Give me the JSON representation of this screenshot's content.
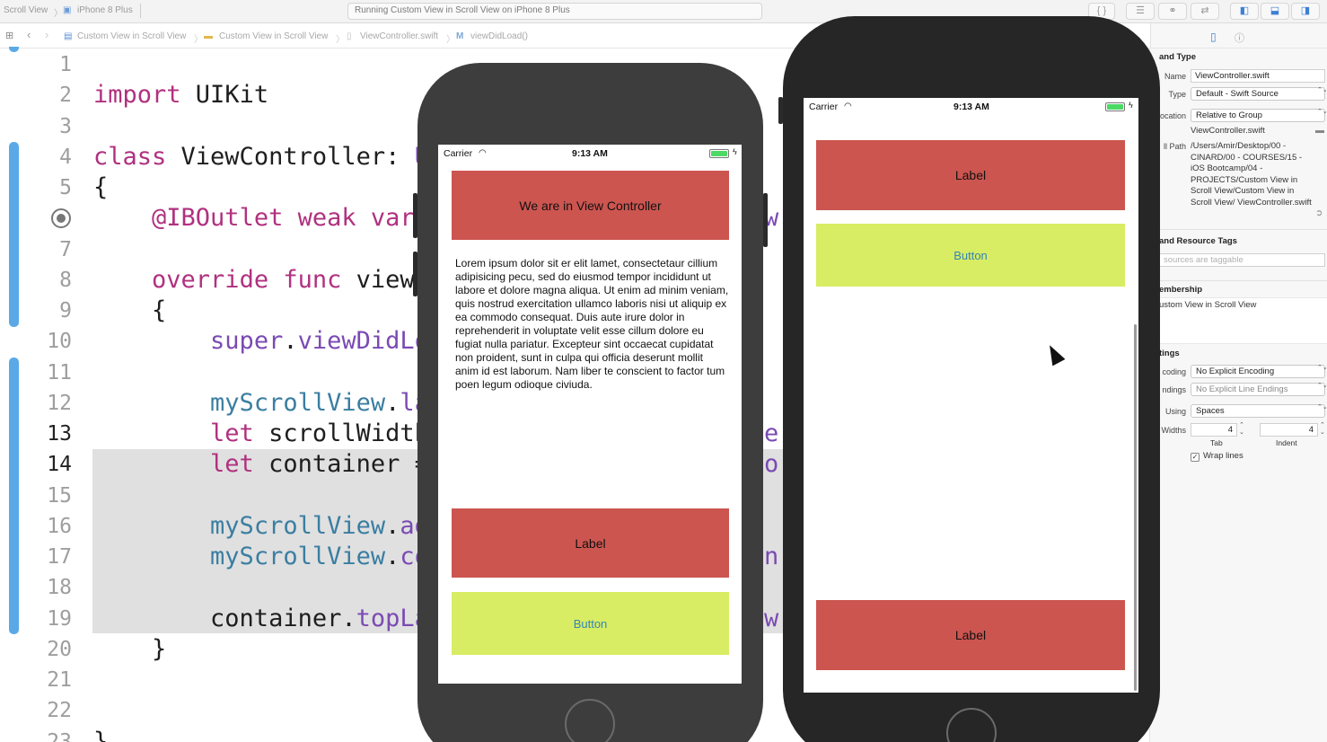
{
  "toolbar": {
    "crumb_project": "Scroll View",
    "crumb_device": "iPhone 8 Plus",
    "status": "Running Custom View in Scroll View on iPhone 8 Plus"
  },
  "jumpbar": {
    "items": [
      "Custom View in Scroll View",
      "Custom View in Scroll View",
      "ViewController.swift",
      "viewDidLoad()"
    ]
  },
  "editor": {
    "lines": [
      {
        "n": "1",
        "html": ""
      },
      {
        "n": "2",
        "html": "<span class='kw'>import</span> UIKit"
      },
      {
        "n": "3",
        "html": ""
      },
      {
        "n": "4",
        "html": "<span class='kw'>class</span> ViewController: <span class='prp'>U</span>"
      },
      {
        "n": "5",
        "html": "{"
      },
      {
        "n": "",
        "html": "    <span class='kw'>@IBOutlet weak var</span>"
      },
      {
        "n": "7",
        "html": ""
      },
      {
        "n": "8",
        "html": "    <span class='kw'>override func</span> viewD"
      },
      {
        "n": "9",
        "html": "    {"
      },
      {
        "n": "10",
        "html": "        <span class='prp'>super</span>.<span class='prp'>viewDidLo</span>"
      },
      {
        "n": "11",
        "html": ""
      },
      {
        "n": "12",
        "html": "        <span class='fn'>myScrollView</span>.<span class='prp'>lay</span>"
      },
      {
        "n": "13",
        "html": "        <span class='kw'>let</span> scrollWidth"
      },
      {
        "n": "14",
        "html": "        <span class='kw'>let</span> container ="
      },
      {
        "n": "15",
        "html": ""
      },
      {
        "n": "16",
        "html": "        <span class='fn'>myScrollView</span>.<span class='prp'>add</span>"
      },
      {
        "n": "17",
        "html": "        <span class='fn'>myScrollView</span>.<span class='prp'>co</span>"
      },
      {
        "n": "18",
        "html": ""
      },
      {
        "n": "19",
        "html": "        container.<span class='prp'>topLa</span>"
      },
      {
        "n": "20",
        "html": "    }"
      },
      {
        "n": "21",
        "html": ""
      },
      {
        "n": "22",
        "html": ""
      },
      {
        "n": "23",
        "html": "}"
      }
    ],
    "peek_right": [
      {
        "text": "w",
        "row": 5
      },
      {
        "text": "e",
        "row": 12
      },
      {
        "text": "o",
        "row": 13
      },
      {
        "text": "n",
        "row": 16
      },
      {
        "text": "w",
        "row": 18
      }
    ]
  },
  "phone_small": {
    "carrier": "Carrier",
    "time": "9:13 AM",
    "header": "We are in View Controller",
    "lorem": "Lorem ipsum dolor sit er elit lamet, consectetaur cillium adipisicing pecu, sed do eiusmod tempor incididunt ut labore et dolore magna aliqua. Ut enim ad minim veniam, quis nostrud exercitation ullamco laboris nisi ut aliquip ex ea commodo consequat. Duis aute irure dolor in reprehenderit in voluptate velit esse cillum dolore eu fugiat nulla pariatur. Excepteur sint occaecat cupidatat non proident, sunt in culpa qui officia deserunt mollit anim id est laborum. Nam liber te conscient to factor tum poen legum odioque civiuda.",
    "label": "Label",
    "button": "Button"
  },
  "phone_large": {
    "carrier": "Carrier",
    "time": "9:13 AM",
    "label_top": "Label",
    "button": "Button",
    "label_bottom": "Label"
  },
  "inspector": {
    "identity_title": "and Type",
    "name_label": "Name",
    "name_value": "ViewController.swift",
    "type_label": "Type",
    "type_value": "Default - Swift Source",
    "location_label": "ocation",
    "location_value": "Relative to Group",
    "location_file": "ViewController.swift",
    "path_label": "ll Path",
    "full_path": "/Users/Amir/Desktop/00 - CINARD/00 - COURSES/15 - iOS Bootcamp/04 - PROJECTS/Custom View in Scroll View/Custom View in Scroll View/ ViewController.swift",
    "tags_title": "and Resource Tags",
    "tags_placeholder": "sources are taggable",
    "membership_title": "embership",
    "membership_item": "ustom View in Scroll View",
    "settings_title": "tings",
    "encoding_label": "coding",
    "encoding_value": "No Explicit Encoding",
    "endings_label": "ndings",
    "endings_value": "No Explicit Line Endings",
    "indent_using_label": "Using",
    "indent_using_value": "Spaces",
    "widths_label": "Widths",
    "tab_value": "4",
    "indent_value": "4",
    "tab_caption": "Tab",
    "indent_caption": "Indent",
    "wrap_lines": "Wrap lines"
  }
}
